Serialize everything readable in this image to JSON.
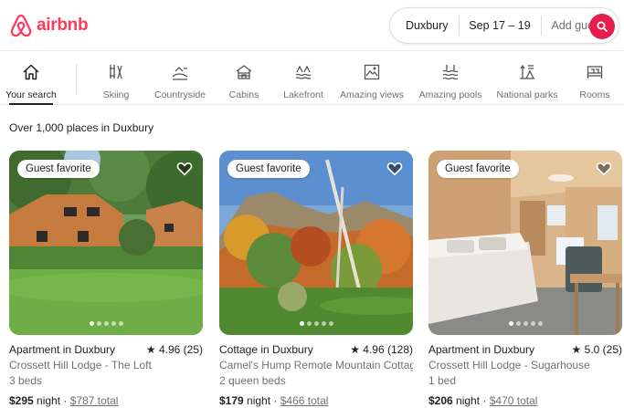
{
  "brand": {
    "name": "airbnb",
    "color": "#ff385c"
  },
  "search": {
    "where": "Duxbury",
    "dates": "Sep 17 – 19",
    "guests": "Add guests",
    "search_icon": "search-icon"
  },
  "categories": [
    {
      "label": "Your search",
      "icon": "home-icon",
      "active": true
    },
    {
      "label": "Skiing",
      "icon": "skiing-icon"
    },
    {
      "label": "Countryside",
      "icon": "countryside-icon"
    },
    {
      "label": "Cabins",
      "icon": "cabin-icon"
    },
    {
      "label": "Lakefront",
      "icon": "lakefront-icon"
    },
    {
      "label": "Amazing views",
      "icon": "amazing-views-icon"
    },
    {
      "label": "Amazing pools",
      "icon": "pool-icon"
    },
    {
      "label": "National parks",
      "icon": "national-park-icon"
    },
    {
      "label": "Rooms",
      "icon": "room-icon"
    }
  ],
  "results": {
    "count_text": "Over 1,000 places in Duxbury"
  },
  "listings": [
    {
      "badge": "Guest favorite",
      "title": "Apartment in Duxbury",
      "rating": "4.96 (25)",
      "name": "Crossett Hill Lodge - The Loft",
      "beds": "3 beds",
      "price": "$295",
      "price_unit": "night",
      "total": "$787 total",
      "photo_count": 5,
      "photo_index": 0
    },
    {
      "badge": "Guest favorite",
      "title": "Cottage in Duxbury",
      "rating": "4.96 (128)",
      "name": "Camel's Hump Remote Mountain Cottage",
      "beds": "2 queen beds",
      "price": "$179",
      "price_unit": "night",
      "total": "$466 total",
      "photo_count": 5,
      "photo_index": 0
    },
    {
      "badge": "Guest favorite",
      "title": "Apartment in Duxbury",
      "rating": "5.0 (25)",
      "name": "Crossett Hill Lodge - Sugarhouse",
      "beds": "1 bed",
      "price": "$206",
      "price_unit": "night",
      "total": "$470 total",
      "photo_count": 5,
      "photo_index": 0
    }
  ]
}
